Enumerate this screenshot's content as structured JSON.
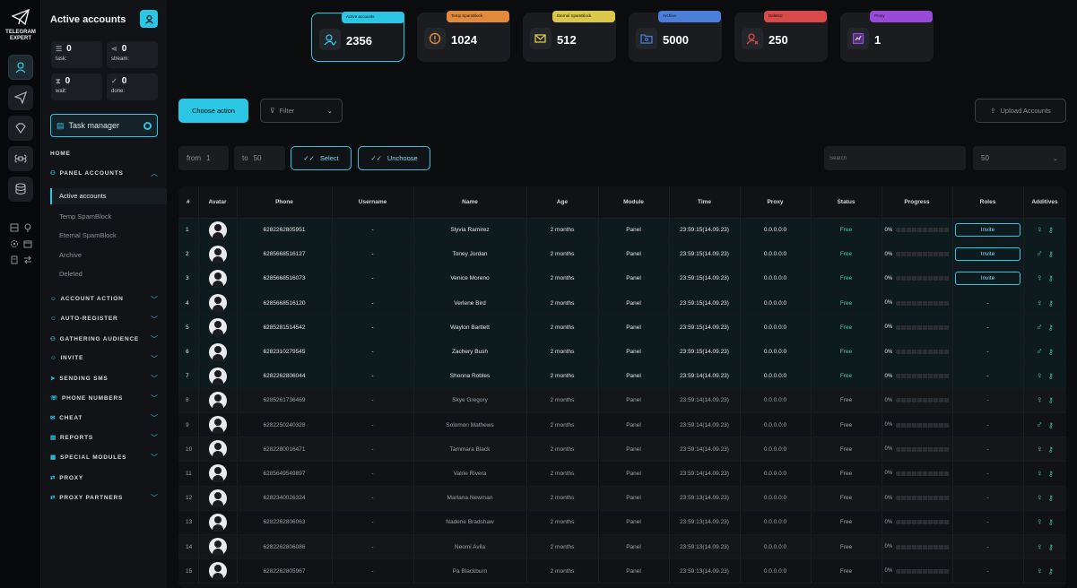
{
  "brand": {
    "line1": "TELEGRAM",
    "line2": "EXPERT"
  },
  "sidebar": {
    "title": "Active accounts",
    "stats": [
      {
        "value": "0",
        "label": "task:"
      },
      {
        "value": "0",
        "label": "stream:"
      },
      {
        "value": "0",
        "label": "wait:"
      },
      {
        "value": "0",
        "label": "done:"
      }
    ],
    "task_manager": "Task manager",
    "home": "HOME",
    "panel_accounts": "PANEL ACCOUNTS",
    "sub_items": [
      "Active accounts",
      "Temp SpamBlock",
      "Eternal SpamBlock",
      "Archive",
      "Deleted"
    ],
    "sections": [
      "ACCOUNT ACTION",
      "AUTO-REGISTER",
      "GATHERING AUDIENCE",
      "INVITE",
      "SENDING SMS",
      "PHONE NUMBERS",
      "CHEAT",
      "REPORTS",
      "SPECIAL MODULES",
      "PROXY",
      "PROXY PARTNERS"
    ]
  },
  "cards": [
    {
      "tag": "Active accounts",
      "value": "2356",
      "color": "#2bc6e4"
    },
    {
      "tag": "Temp SpamBlock",
      "value": "1024",
      "color": "#e08a3c"
    },
    {
      "tag": "Eternal SpamBlock",
      "value": "512",
      "color": "#d9c84a"
    },
    {
      "tag": "Archive",
      "value": "5000",
      "color": "#4a7ed9"
    },
    {
      "tag": "Deleted",
      "value": "250",
      "color": "#d94a4a"
    },
    {
      "tag": "Proxy",
      "value": "1",
      "color": "#9a4ad9"
    }
  ],
  "toolbar": {
    "choose_action": "Choose action",
    "filter": "Filter",
    "upload": "Upload Accounts",
    "from_label": "from",
    "from_value": "1",
    "to_label": "to",
    "to_value": "50",
    "select": "Select",
    "unchoose": "Unchoose",
    "search_placeholder": "Search",
    "per_page": "50"
  },
  "table": {
    "headers": [
      "#",
      "Avatar",
      "Phone",
      "Username",
      "Name",
      "Age",
      "Module",
      "Time",
      "Proxy",
      "Status",
      "Progress",
      "Roles",
      "Additives"
    ],
    "rows": [
      {
        "n": "1",
        "phone": "6282262805951",
        "user": "-",
        "name": "Slyvia Ramirez",
        "age": "2 months",
        "module": "Panel",
        "time": "23:59:15(14.09.23)",
        "proxy": "0.0.0.0:0",
        "status": "Free",
        "progress": "0%",
        "role": "Invite",
        "sex": "f"
      },
      {
        "n": "2",
        "phone": "6285668516127",
        "user": "-",
        "name": "Toney Jordan",
        "age": "2 months",
        "module": "Panel",
        "time": "23:59:15(14.09.23)",
        "proxy": "0.0.0.0:0",
        "status": "Free",
        "progress": "0%",
        "role": "Invite",
        "sex": "m"
      },
      {
        "n": "3",
        "phone": "6285668516073",
        "user": "-",
        "name": "Venice Moreno",
        "age": "2 months",
        "module": "Panel",
        "time": "23:59:15(14.09.23)",
        "proxy": "0.0.0.0:0",
        "status": "Free",
        "progress": "0%",
        "role": "Invite",
        "sex": "f"
      },
      {
        "n": "4",
        "phone": "6285668516120",
        "user": "-",
        "name": "Verlene Bird",
        "age": "2 months",
        "module": "Panel",
        "time": "23:59:15(14.09.23)",
        "proxy": "0.0.0.0:0",
        "status": "Free",
        "progress": "0%",
        "role": "-",
        "sex": "f"
      },
      {
        "n": "5",
        "phone": "6285281514542",
        "user": "-",
        "name": "Waylon Bartlett",
        "age": "2 months",
        "module": "Panel",
        "time": "23:59:15(14.09.23)",
        "proxy": "0.0.0.0:0",
        "status": "Free",
        "progress": "0%",
        "role": "-",
        "sex": "m"
      },
      {
        "n": "6",
        "phone": "6282310279545",
        "user": "-",
        "name": "Zachery Bush",
        "age": "2 months",
        "module": "Panel",
        "time": "23:59:15(14.09.23)",
        "proxy": "0.0.0.0:0",
        "status": "Free",
        "progress": "0%",
        "role": "-",
        "sex": "m"
      },
      {
        "n": "7",
        "phone": "6282262806044",
        "user": "-",
        "name": "Shonna Robles",
        "age": "2 months",
        "module": "Panel",
        "time": "23:59:14(14.09.23)",
        "proxy": "0.0.0.0:0",
        "status": "Free",
        "progress": "0%",
        "role": "-",
        "sex": "f"
      },
      {
        "n": "8",
        "phone": "6285261736469",
        "user": "-",
        "name": "Skye Gregory",
        "age": "2 months",
        "module": "Panel",
        "time": "23:59:14(14.09.23)",
        "proxy": "0.0.0.0:0",
        "status": "Free",
        "progress": "0%",
        "role": "-",
        "sex": "f"
      },
      {
        "n": "9",
        "phone": "6282250240328",
        "user": "-",
        "name": "Solomon Mathews",
        "age": "2 months",
        "module": "Panel",
        "time": "23:59:14(14.09.23)",
        "proxy": "0.0.0.0:0",
        "status": "Free",
        "progress": "0%",
        "role": "-",
        "sex": "m"
      },
      {
        "n": "10",
        "phone": "6282280016471",
        "user": "-",
        "name": "Tammara Black",
        "age": "2 months",
        "module": "Panel",
        "time": "23:59:14(14.09.23)",
        "proxy": "0.0.0.0:0",
        "status": "Free",
        "progress": "0%",
        "role": "-",
        "sex": "f"
      },
      {
        "n": "11",
        "phone": "6285649549897",
        "user": "-",
        "name": "Valrie Rivera",
        "age": "2 months",
        "module": "Panel",
        "time": "23:59:14(14.09.23)",
        "proxy": "0.0.0.0:0",
        "status": "Free",
        "progress": "0%",
        "role": "-",
        "sex": "f"
      },
      {
        "n": "12",
        "phone": "6282340026324",
        "user": "-",
        "name": "Marlana Newman",
        "age": "2 months",
        "module": "Panel",
        "time": "23:59:13(14.09.23)",
        "proxy": "0.0.0.0:0",
        "status": "Free",
        "progress": "0%",
        "role": "-",
        "sex": "f"
      },
      {
        "n": "13",
        "phone": "6282262806063",
        "user": "-",
        "name": "Nadene Bradshaw",
        "age": "2 months",
        "module": "Panel",
        "time": "23:59:13(14.09.23)",
        "proxy": "0.0.0.0:0",
        "status": "Free",
        "progress": "0%",
        "role": "-",
        "sex": "f"
      },
      {
        "n": "14",
        "phone": "6282262806086",
        "user": "-",
        "name": "Neomi Avila",
        "age": "2 months",
        "module": "Panel",
        "time": "23:59:13(14.09.23)",
        "proxy": "0.0.0.0:0",
        "status": "Free",
        "progress": "0%",
        "role": "-",
        "sex": "f"
      },
      {
        "n": "15",
        "phone": "6282262805967",
        "user": "-",
        "name": "Pa Blackburn",
        "age": "2 months",
        "module": "Panel",
        "time": "23:59:13(14.09.23)",
        "proxy": "0.0.0.0:0",
        "status": "Free",
        "progress": "0%",
        "role": "-",
        "sex": "f"
      }
    ]
  },
  "colors": {
    "accent": "#2bc6e4",
    "free": "#3ad0a0"
  }
}
